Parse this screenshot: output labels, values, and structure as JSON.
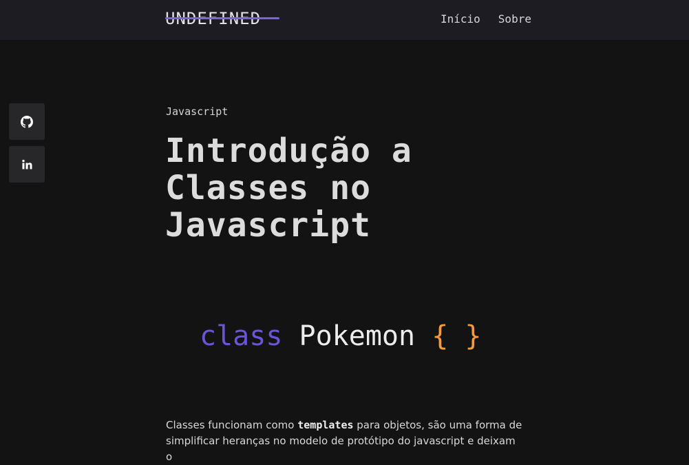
{
  "header": {
    "logo": "UNDEFINED",
    "nav": [
      {
        "label": "Início"
      },
      {
        "label": "Sobre"
      }
    ],
    "accent_color": "#7c63d8"
  },
  "social": [
    {
      "icon": "github-icon"
    },
    {
      "icon": "linkedin-icon",
      "glyph": "in"
    }
  ],
  "article": {
    "category": "Javascript",
    "title": "Introdução a Classes no Javascript",
    "hero_code": {
      "keyword": "class",
      "name": "Pokemon",
      "braces": "{ }",
      "keyword_color": "#6a55d8",
      "brace_color": "#f19a3e"
    },
    "intro": {
      "before": "Classes funcionam como ",
      "emphasis": "templates",
      "after": " para objetos, são uma forma de simplificar heranças no modelo de protótipo do javascript e deixam o"
    }
  }
}
